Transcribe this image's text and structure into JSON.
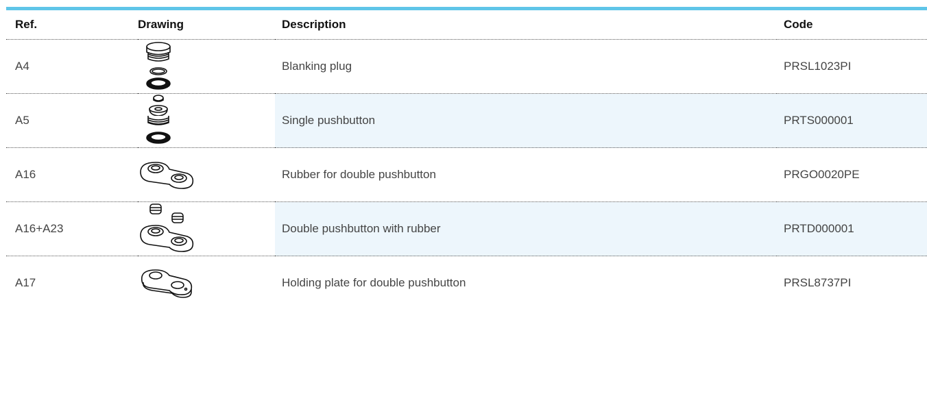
{
  "header": {
    "ref": "Ref.",
    "drawing": "Drawing",
    "description": "Description",
    "code": "Code"
  },
  "rows": [
    {
      "ref": "A4",
      "drawing_icon": "blanking-plug-icon",
      "description": "Blanking plug",
      "code": "PRSL1023PI"
    },
    {
      "ref": "A5",
      "drawing_icon": "single-pushbutton-icon",
      "description": "Single pushbutton",
      "code": "PRTS000001"
    },
    {
      "ref": "A16",
      "drawing_icon": "rubber-double-pushbutton-icon",
      "description": "Rubber for double pushbutton",
      "code": "PRGO0020PE"
    },
    {
      "ref": "A16+A23",
      "drawing_icon": "double-pushbutton-with-rubber-icon",
      "description": "Double pushbutton with rubber",
      "code": "PRTD000001"
    },
    {
      "ref": "A17",
      "drawing_icon": "holding-plate-icon",
      "description": "Holding plate for double pushbutton",
      "code": "PRSL8737PI"
    }
  ],
  "colors": {
    "accent": "#5fc5e8",
    "shade": "#edf6fc"
  }
}
